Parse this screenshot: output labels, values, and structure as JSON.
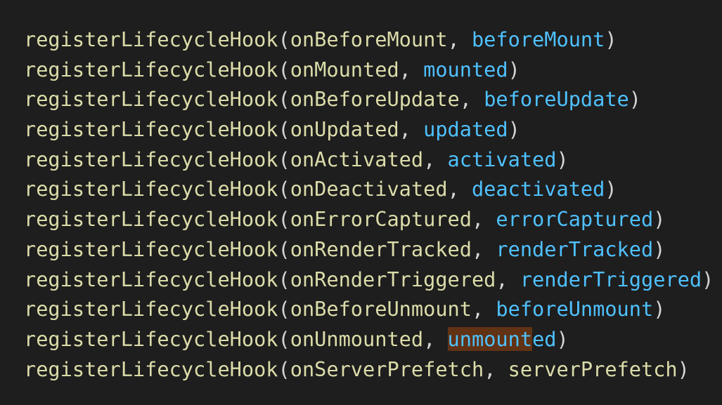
{
  "editor": {
    "lines": [
      {
        "fn": "registerLifecycleHook",
        "open": "(",
        "arg1": "onBeforeMount",
        "sep": ", ",
        "arg2": "beforeMount",
        "close": ")"
      },
      {
        "fn": "registerLifecycleHook",
        "open": "(",
        "arg1": "onMounted",
        "sep": ", ",
        "arg2": "mounted",
        "close": ")"
      },
      {
        "fn": "registerLifecycleHook",
        "open": "(",
        "arg1": "onBeforeUpdate",
        "sep": ", ",
        "arg2": "beforeUpdate",
        "close": ")"
      },
      {
        "fn": "registerLifecycleHook",
        "open": "(",
        "arg1": "onUpdated",
        "sep": ", ",
        "arg2": "updated",
        "close": ")"
      },
      {
        "fn": "registerLifecycleHook",
        "open": "(",
        "arg1": "onActivated",
        "sep": ", ",
        "arg2": "activated",
        "close": ")"
      },
      {
        "fn": "registerLifecycleHook",
        "open": "(",
        "arg1": "onDeactivated",
        "sep": ", ",
        "arg2": "deactivated",
        "close": ")"
      },
      {
        "fn": "registerLifecycleHook",
        "open": "(",
        "arg1": "onErrorCaptured",
        "sep": ", ",
        "arg2": "errorCaptured",
        "close": ")"
      },
      {
        "fn": "registerLifecycleHook",
        "open": "(",
        "arg1": "onRenderTracked",
        "sep": ", ",
        "arg2": "renderTracked",
        "close": ")"
      },
      {
        "fn": "registerLifecycleHook",
        "open": "(",
        "arg1": "onRenderTriggered",
        "sep": ", ",
        "arg2": "renderTriggered",
        "close": ")"
      },
      {
        "fn": "registerLifecycleHook",
        "open": "(",
        "arg1": "onBeforeUnmount",
        "sep": ", ",
        "arg2": "beforeUnmount",
        "close": ")"
      },
      {
        "fn": "registerLifecycleHook",
        "open": "(",
        "arg1": "onUnmounted",
        "sep": ", ",
        "arg2_highlighted": "unmount",
        "arg2_rest": "ed",
        "close": ")"
      },
      {
        "fn": "registerLifecycleHook",
        "open": "(",
        "arg1": "onServerPrefetch",
        "sep": ", ",
        "arg2": "serverPrefetch",
        "close": ")"
      }
    ]
  },
  "colors": {
    "background": "#1e1e1e",
    "function": "#dcdcaa",
    "punctuation": "#d4d4d4",
    "variable": "#4fc1ff",
    "highlight": "#613214"
  }
}
